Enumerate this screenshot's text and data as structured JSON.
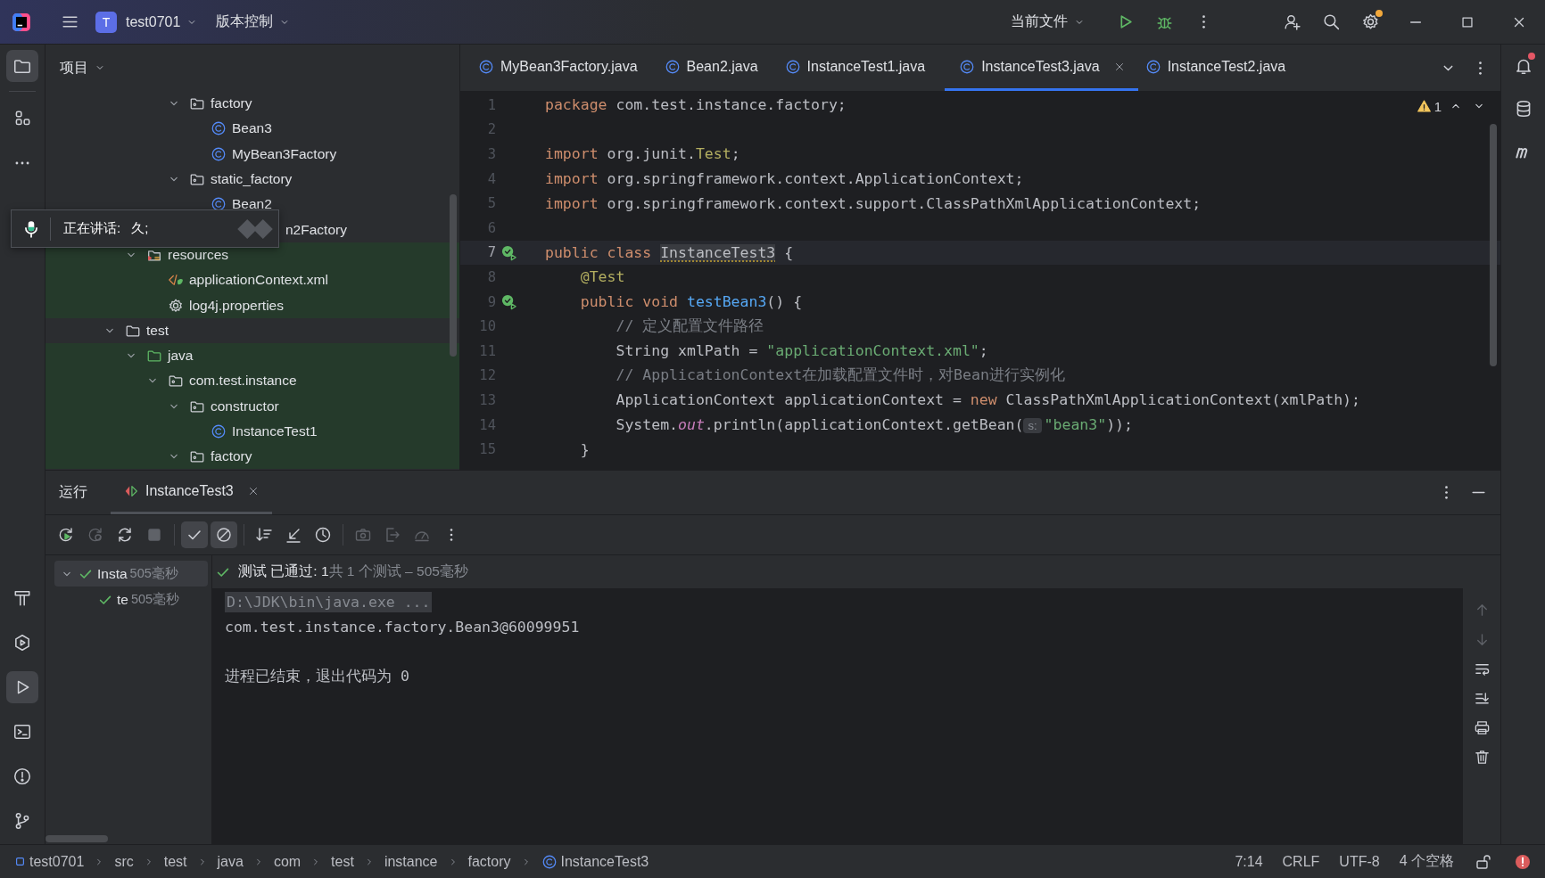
{
  "title_bar": {
    "project_initial": "T",
    "project": "test0701",
    "vcs_menu": "版本控制",
    "run_target": "当前文件",
    "settings_badge": true
  },
  "left_toolbar": {
    "top": [
      {
        "kind": "project",
        "selected": true
      },
      {
        "kind": "structure",
        "selected": false
      },
      {
        "kind": "more",
        "selected": false
      }
    ],
    "bottom": [
      {
        "kind": "build",
        "selected": false
      },
      {
        "kind": "services",
        "selected": false
      },
      {
        "kind": "run",
        "selected": true
      },
      {
        "kind": "terminal",
        "selected": false
      },
      {
        "kind": "problems",
        "selected": false
      },
      {
        "kind": "git",
        "selected": false
      }
    ]
  },
  "right_toolbar": {
    "notifications_badge": true,
    "items": [
      {
        "kind": "database"
      },
      {
        "kind": "maven"
      }
    ]
  },
  "project_panel": {
    "title": "项目",
    "tree": [
      {
        "label": "factory",
        "kind": "package",
        "expanded": true,
        "highlighted": false,
        "children": [
          {
            "label": "Bean3",
            "kind": "class",
            "highlighted": false
          },
          {
            "label": "MyBean3Factory",
            "kind": "class",
            "highlighted": false
          }
        ]
      },
      {
        "label": "static_factory",
        "kind": "package",
        "expanded": true,
        "highlighted": false,
        "children": [
          {
            "label": "Bean2",
            "kind": "class",
            "highlighted": false
          },
          {
            "label": "n2Factory",
            "kind": "covered",
            "highlighted": false
          }
        ]
      },
      {
        "label": "resources",
        "kind": "resources",
        "expanded": true,
        "highlighted": true,
        "children": [
          {
            "label": "applicationContext.xml",
            "kind": "xml",
            "highlighted": true
          },
          {
            "label": "log4j.properties",
            "kind": "properties",
            "highlighted": true
          }
        ]
      },
      {
        "label": "test",
        "kind": "folder",
        "expanded": true,
        "highlighted": false,
        "children": [
          {
            "label": "java",
            "kind": "test-root",
            "expanded": true,
            "highlighted": true,
            "children": [
              {
                "label": "com.test.instance",
                "kind": "package",
                "expanded": true,
                "highlighted": true,
                "children": [
                  {
                    "label": "constructor",
                    "kind": "package",
                    "expanded": true,
                    "highlighted": true,
                    "children": [
                      {
                        "label": "InstanceTest1",
                        "kind": "class",
                        "highlighted": true
                      }
                    ]
                  },
                  {
                    "label": "factory",
                    "kind": "package",
                    "expanded": true,
                    "highlighted": true
                  }
                ]
              }
            ]
          }
        ]
      }
    ]
  },
  "voice_popup": {
    "label": "正在讲话:",
    "speaker": "久;"
  },
  "editor": {
    "tabs": [
      {
        "label": "MyBean3Factory.java",
        "selected": false
      },
      {
        "label": "Bean2.java",
        "selected": false
      },
      {
        "label": "InstanceTest1.java",
        "selected": false
      },
      {
        "label": "InstanceTest3.java",
        "selected": true
      },
      {
        "label": "InstanceTest2.java",
        "selected": false
      }
    ],
    "warnings": "1",
    "lines": [
      {
        "number": "1",
        "current": false,
        "run_marker": false,
        "segments": [
          {
            "kind": "keyword",
            "text": "package"
          },
          {
            "kind": "plain",
            "text": " com.test.instance.factory;"
          }
        ]
      },
      {
        "number": "2",
        "current": false,
        "run_marker": false
      },
      {
        "number": "3",
        "current": false,
        "run_marker": false,
        "segments": [
          {
            "kind": "keyword",
            "text": "import"
          },
          {
            "kind": "plain",
            "text": " org.junit."
          },
          {
            "kind": "annotation",
            "text": "Test"
          },
          {
            "kind": "plain",
            "text": ";"
          }
        ]
      },
      {
        "number": "4",
        "current": false,
        "run_marker": false,
        "segments": [
          {
            "kind": "keyword",
            "text": "import"
          },
          {
            "kind": "plain",
            "text": " org.springframework.context.ApplicationContext;"
          }
        ]
      },
      {
        "number": "5",
        "current": false,
        "run_marker": false,
        "segments": [
          {
            "kind": "keyword",
            "text": "import"
          },
          {
            "kind": "plain",
            "text": " org.springframework.context.support.ClassPathXmlApplicationContext;"
          }
        ]
      },
      {
        "number": "6",
        "current": false,
        "run_marker": false
      },
      {
        "number": "7",
        "current": true,
        "run_marker": true,
        "segments": [
          {
            "kind": "keyword",
            "text": "public class "
          },
          {
            "kind": "warning",
            "text": "InstanceTest3"
          },
          {
            "kind": "plain",
            "text": " {"
          }
        ]
      },
      {
        "number": "8",
        "current": false,
        "run_marker": false,
        "segments": [
          {
            "kind": "annotation",
            "text": "    @Test"
          }
        ]
      },
      {
        "number": "9",
        "current": false,
        "run_marker": true,
        "segments": [
          {
            "kind": "keyword",
            "text": "    public void "
          },
          {
            "kind": "method",
            "text": "testBean3"
          },
          {
            "kind": "plain",
            "text": "() {"
          }
        ]
      },
      {
        "number": "10",
        "current": false,
        "run_marker": false,
        "segments": [
          {
            "kind": "comment",
            "text": "        // 定义配置文件路径"
          }
        ]
      },
      {
        "number": "11",
        "current": false,
        "run_marker": false,
        "segments": [
          {
            "kind": "plain",
            "text": "        String xmlPath = "
          },
          {
            "kind": "string",
            "text": "\"applicationContext.xml\""
          },
          {
            "kind": "plain",
            "text": ";"
          }
        ]
      },
      {
        "number": "12",
        "current": false,
        "run_marker": false,
        "segments": [
          {
            "kind": "comment",
            "text": "        // ApplicationContext在加载配置文件时，对Bean进行实例化"
          }
        ]
      },
      {
        "number": "13",
        "current": false,
        "run_marker": false,
        "segments": [
          {
            "kind": "plain",
            "text": "        ApplicationContext applicationContext = "
          },
          {
            "kind": "keyword",
            "text": "new"
          },
          {
            "kind": "plain",
            "text": " ClassPathXmlApplicationContext(xmlPath);"
          }
        ]
      },
      {
        "number": "14",
        "current": false,
        "run_marker": false,
        "segments": [
          {
            "kind": "plain",
            "text": "        System."
          },
          {
            "kind": "static",
            "text": "out"
          },
          {
            "kind": "plain",
            "text": ".println(applicationContext.getBean("
          },
          {
            "kind": "hint",
            "text": "s:"
          },
          {
            "kind": "string",
            "text": "\"bean3\""
          },
          {
            "kind": "plain",
            "text": "));"
          }
        ]
      },
      {
        "number": "15",
        "current": false,
        "run_marker": false,
        "segments": [
          {
            "kind": "plain",
            "text": "    }"
          }
        ]
      }
    ]
  },
  "run_panel": {
    "title": "运行",
    "tabs": [
      {
        "label": "InstanceTest3",
        "selected": true
      }
    ],
    "toolbar": [
      {
        "kind": "rerun",
        "disabled": false,
        "toggled": false
      },
      {
        "kind": "rerun-failed",
        "disabled": true,
        "toggled": false
      },
      {
        "kind": "auto-test",
        "disabled": false,
        "toggled": false
      },
      {
        "kind": "stop",
        "disabled": true,
        "toggled": false
      },
      {
        "kind": "show-passed",
        "disabled": false,
        "toggled": true
      },
      {
        "kind": "show-ignored",
        "disabled": false,
        "toggled": true
      },
      {
        "kind": "sort",
        "disabled": false,
        "toggled": false
      },
      {
        "kind": "import",
        "disabled": false,
        "toggled": false
      },
      {
        "kind": "history",
        "disabled": false,
        "toggled": false
      },
      {
        "kind": "camera",
        "disabled": true,
        "toggled": false
      },
      {
        "kind": "export",
        "disabled": true,
        "toggled": false
      },
      {
        "kind": "coverage",
        "disabled": true,
        "toggled": false
      },
      {
        "kind": "more",
        "disabled": false,
        "toggled": false
      }
    ],
    "test_tree": [
      {
        "name": "Insta",
        "duration": "505毫秒",
        "passed": true,
        "selected": true,
        "expanded": true,
        "children": [
          {
            "name": "te",
            "duration": "505毫秒",
            "passed": true,
            "selected": false
          }
        ]
      }
    ],
    "result": {
      "passed": true,
      "status": "测试 已通过: 1",
      "summary": "共 1 个测试 – 505毫秒"
    },
    "console": [
      {
        "kind": "command",
        "text": "D:\\JDK\\bin\\java.exe ..."
      },
      {
        "kind": "output",
        "text": "com.test.instance.factory.Bean3@60099951"
      },
      {
        "kind": "blank"
      },
      {
        "kind": "exit",
        "text": "进程已结束，退出代码为 0"
      }
    ],
    "console_tools": [
      {
        "kind": "up",
        "disabled": true
      },
      {
        "kind": "down",
        "disabled": true
      },
      {
        "kind": "wrap",
        "disabled": false
      },
      {
        "kind": "scroll-end",
        "disabled": false
      },
      {
        "kind": "print",
        "disabled": false
      },
      {
        "kind": "clear",
        "disabled": false
      }
    ]
  },
  "status_bar": {
    "breadcrumbs": [
      {
        "kind": "module",
        "label": "test0701"
      },
      {
        "kind": "folder",
        "label": "src"
      },
      {
        "kind": "folder",
        "label": "test"
      },
      {
        "kind": "folder",
        "label": "java"
      },
      {
        "kind": "folder",
        "label": "com"
      },
      {
        "kind": "folder",
        "label": "test"
      },
      {
        "kind": "folder",
        "label": "instance"
      },
      {
        "kind": "folder",
        "label": "factory"
      },
      {
        "kind": "class",
        "label": "InstanceTest3"
      }
    ],
    "position": "7:14",
    "line_separator": "CRLF",
    "encoding": "UTF-8",
    "indent": "4 个空格",
    "locked": false,
    "error": true
  }
}
